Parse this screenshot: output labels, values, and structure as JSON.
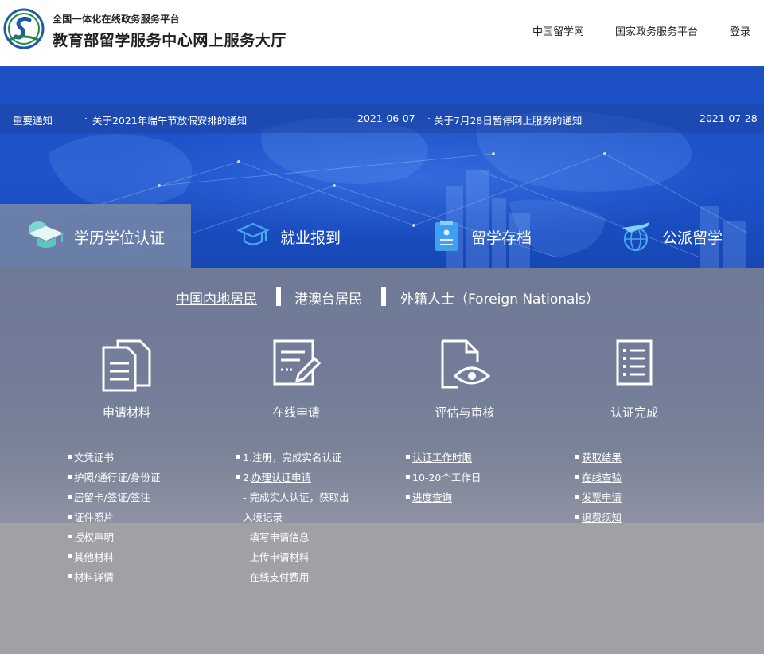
{
  "header": {
    "subtitle": "全国一体化在线政务服务平台",
    "title": "教育部留学服务中心网上服务大厅",
    "links": [
      "中国留学网",
      "国家政务服务平台",
      "登录"
    ]
  },
  "notice": {
    "label": "重要通知",
    "items": [
      {
        "text": "关于2021年端午节放假安排的通知",
        "date": "2021-06-07"
      },
      {
        "text": "关于7月28日暂停网上服务的通知",
        "date": "2021-07-28"
      }
    ]
  },
  "services": [
    {
      "label": "学历学位认证",
      "icon": "graduation-cap-icon",
      "active": true
    },
    {
      "label": "就业报到",
      "icon": "mortarboard-outline-icon",
      "active": false
    },
    {
      "label": "留学存档",
      "icon": "archive-document-icon",
      "active": false
    },
    {
      "label": "公派留学",
      "icon": "globe-plane-icon",
      "active": false
    }
  ],
  "regions": [
    "中国内地居民",
    "港澳台居民",
    "外籍人士（Foreign Nationals）"
  ],
  "steps": [
    {
      "title": "申请材料",
      "icon": "documents-icon",
      "items": [
        {
          "text": "文凭证书",
          "link": false
        },
        {
          "text": "护照/通行证/身份证",
          "link": false
        },
        {
          "text": "居留卡/签证/签注",
          "link": false
        },
        {
          "text": "证件照片",
          "link": false
        },
        {
          "text": "授权声明",
          "link": false
        },
        {
          "text": "其他材料",
          "link": false
        },
        {
          "text": "材料详情",
          "link": true
        }
      ]
    },
    {
      "title": "在线申请",
      "icon": "form-edit-icon",
      "items": [
        {
          "text": "1.注册，完成实名认证",
          "bullet": true
        },
        {
          "prefix": "2.",
          "text": "办理认证申请",
          "bullet": true
        },
        {
          "text": "- 完成实人认证，获取出",
          "bullet": false
        },
        {
          "text": "入境记录",
          "bullet": false
        },
        {
          "text": "- 填写申请信息",
          "bullet": false
        },
        {
          "text": "- 上传申请材料",
          "bullet": false
        },
        {
          "text": "- 在线支付费用",
          "bullet": false
        }
      ]
    },
    {
      "title": "评估与审核",
      "icon": "document-eye-icon",
      "items": [
        {
          "text": "认证工作时限",
          "link": true
        },
        {
          "text": "10-20个工作日",
          "link": false
        },
        {
          "text": "进度查询",
          "link": true
        }
      ]
    },
    {
      "title": "认证完成",
      "icon": "checklist-icon",
      "items": [
        {
          "text": "获取结果",
          "link": true
        },
        {
          "text": "在线查验",
          "link": true
        },
        {
          "text": "发票申请",
          "link": true
        },
        {
          "text": "退费须知",
          "link": true
        }
      ]
    }
  ]
}
